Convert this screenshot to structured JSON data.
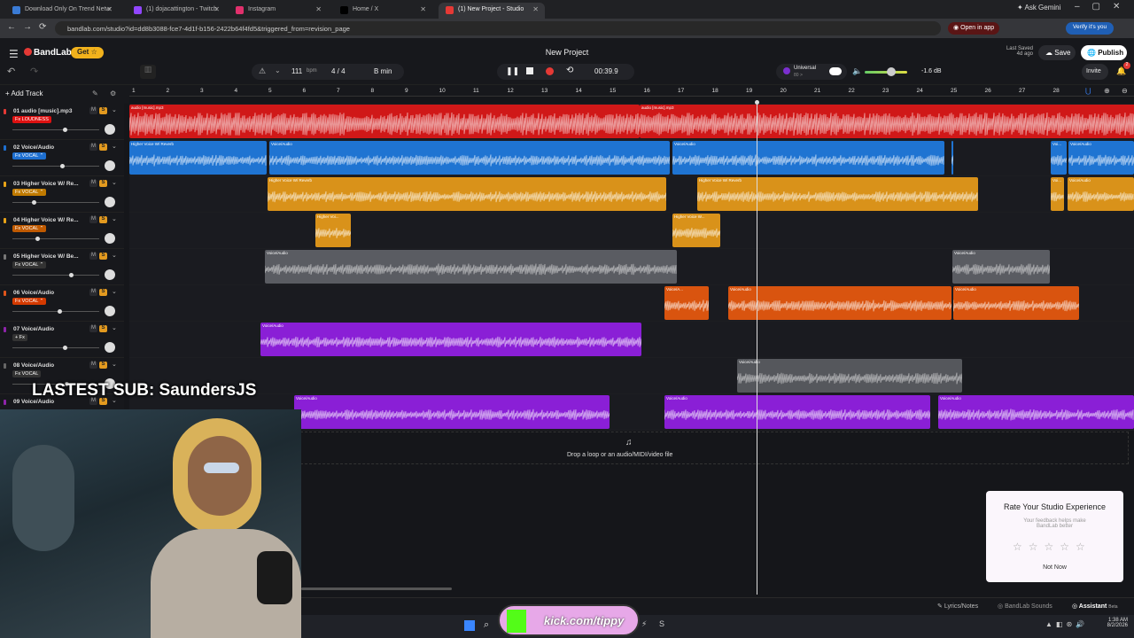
{
  "browser": {
    "tabs": [
      {
        "label": "Download Only On Trend Netw",
        "color": "#3a7bd5"
      },
      {
        "label": "(1) dojacattington - Twitch",
        "color": "#9146ff"
      },
      {
        "label": "Instagram",
        "color": "#e1306c"
      },
      {
        "label": "Home / X",
        "color": "#000000"
      },
      {
        "label": "(1) New Project - Studio",
        "color": "#e53935"
      }
    ],
    "url": "bandlab.com/studio?id=dd8b3088-fce7-4d1f-b156-2422b64f4fd5&triggered_from=revision_page",
    "gemini": "Ask Gemini",
    "open_in_app": "Open in app",
    "verify": "Verify it's you"
  },
  "app": {
    "brand": "BandLab",
    "get": "Get",
    "title": "New Project",
    "last_saved": "Last Saved",
    "last_saved_ago": "4d ago",
    "save": "Save",
    "publish": "Publish",
    "invite": "Invite",
    "notif_count": "2"
  },
  "transport": {
    "tempo": "111",
    "bpm": "bpm",
    "sig": "4 / 4",
    "key": "B min",
    "time": "00:39.9",
    "universal": "Universal",
    "universal_sub": "80 >",
    "db": "-1.6 dB"
  },
  "left": {
    "add_track": "Add Track"
  },
  "ruler": [
    "1",
    "2",
    "3",
    "4",
    "5",
    "6",
    "7",
    "8",
    "9",
    "10",
    "11",
    "12",
    "13",
    "14",
    "15",
    "16",
    "17",
    "18",
    "19",
    "20",
    "21",
    "22",
    "23",
    "24",
    "25",
    "26",
    "27",
    "28"
  ],
  "tracks": [
    {
      "name": "01  audio [music].mp3",
      "fx": "Fx LOUDNESS",
      "fxcolor": "#d11",
      "dot": "#e53935",
      "vol": 0.58
    },
    {
      "name": "02  Voice/Audio",
      "fx": "Fx VOCAL ⌃",
      "fxcolor": "#1e6fd0",
      "dot": "#1e6fd0",
      "vol": 0.55
    },
    {
      "name": "03  Higher Voice W/ Re...",
      "fx": "Fx VOCAL ⌃",
      "fxcolor": "#c07a00",
      "dot": "#e8a317",
      "vol": 0.22
    },
    {
      "name": "04  Higher Voice W/ Re...",
      "fx": "Fx VOCAL ⌃",
      "fxcolor": "#c05a00",
      "dot": "#e8a317",
      "vol": 0.27
    },
    {
      "name": "05  Higher Voice W/ Be...",
      "fx": "Fx VOCAL ⌃",
      "fxcolor": "#333",
      "dot": "#777",
      "vol": 0.65
    },
    {
      "name": "06  Voice/Audio",
      "fx": "Fx VOCAL ⌃",
      "fxcolor": "#d43a00",
      "dot": "#e0551b",
      "vol": 0.52
    },
    {
      "name": "07  Voice/Audio",
      "fx": "+ Fx",
      "fxcolor": "#333",
      "dot": "#8e24aa",
      "vol": 0.58
    },
    {
      "name": "08  Voice/Audio",
      "fx": "Fx VOCAL",
      "fxcolor": "#333",
      "dot": "#666",
      "vol": 0.6
    },
    {
      "name": "09  Voice/Audio",
      "fx": "",
      "fxcolor": "#7b1fa2",
      "dot": "#8e24aa",
      "vol": 0.5
    }
  ],
  "clips": [
    [
      {
        "label": "audio [music].mp3",
        "color": "#d01818"
      },
      {
        "label": "audio [music].mp3",
        "color": "#d01818"
      }
    ],
    [
      {
        "label": "Higher Voice W/ Reverb",
        "color": "#1f74d2"
      },
      {
        "label": "Voice/Audio",
        "color": "#1f74d2"
      },
      {
        "label": "Voice/Audio",
        "color": "#1f74d2"
      },
      {
        "label": "Voice/Audio",
        "color": "#1f74d2"
      },
      {
        "label": "Voi...",
        "color": "#1f74d2"
      },
      {
        "label": "Voice/Audio",
        "color": "#1f74d2"
      }
    ],
    [
      {
        "label": "Higher Voice W/ Reverb",
        "color": "#d9921a"
      },
      {
        "label": "Higher Voice W/ Reverb",
        "color": "#d9921a"
      },
      {
        "label": "Voi...",
        "color": "#d9921a"
      },
      {
        "label": "Voice/Audio",
        "color": "#d9921a"
      }
    ],
    [
      {
        "label": "Higher Voi...",
        "color": "#d9921a"
      },
      {
        "label": "Higher Voice W...",
        "color": "#d9921a"
      }
    ],
    [
      {
        "label": "Voice/Audio",
        "color": "#5a5c62"
      },
      {
        "label": "Voice/Audio",
        "color": "#5a5c62"
      }
    ],
    [
      {
        "label": "Voice/A...",
        "color": "#d9540f"
      },
      {
        "label": "Voice/Audio",
        "color": "#d9540f"
      },
      {
        "label": "Voice/Audio",
        "color": "#d9540f"
      }
    ],
    [
      {
        "label": "Voice/Audio",
        "color": "#8a1fd6"
      }
    ],
    [
      {
        "label": "Voice/Audio",
        "color": "#55575c"
      }
    ],
    [
      {
        "label": "Voice/Audio",
        "color": "#8a1fd6"
      },
      {
        "label": "Voice/Audio",
        "color": "#8a1fd6"
      },
      {
        "label": "Voice/Audio",
        "color": "#8a1fd6"
      },
      {
        "label": "Voice/Audio",
        "color": "#8a1fd6"
      }
    ]
  ],
  "drop": "Drop a loop or an audio/MIDI/video file",
  "rating": {
    "title": "Rate Your Studio Experience",
    "sub": "Your feedback helps make BandLab better",
    "not_now": "Not Now"
  },
  "overlay": {
    "sub": "LASTEST SUB: SaundersJS",
    "kick": "kick.com/tippy"
  },
  "bottom": {
    "lyrics": "Lyrics/Notes",
    "sounds": "BandLab Sounds",
    "assistant": "Assistant",
    "beta": "Beta"
  },
  "taskbar": {
    "time": "1:38 AM",
    "date": "8/2/2026"
  }
}
